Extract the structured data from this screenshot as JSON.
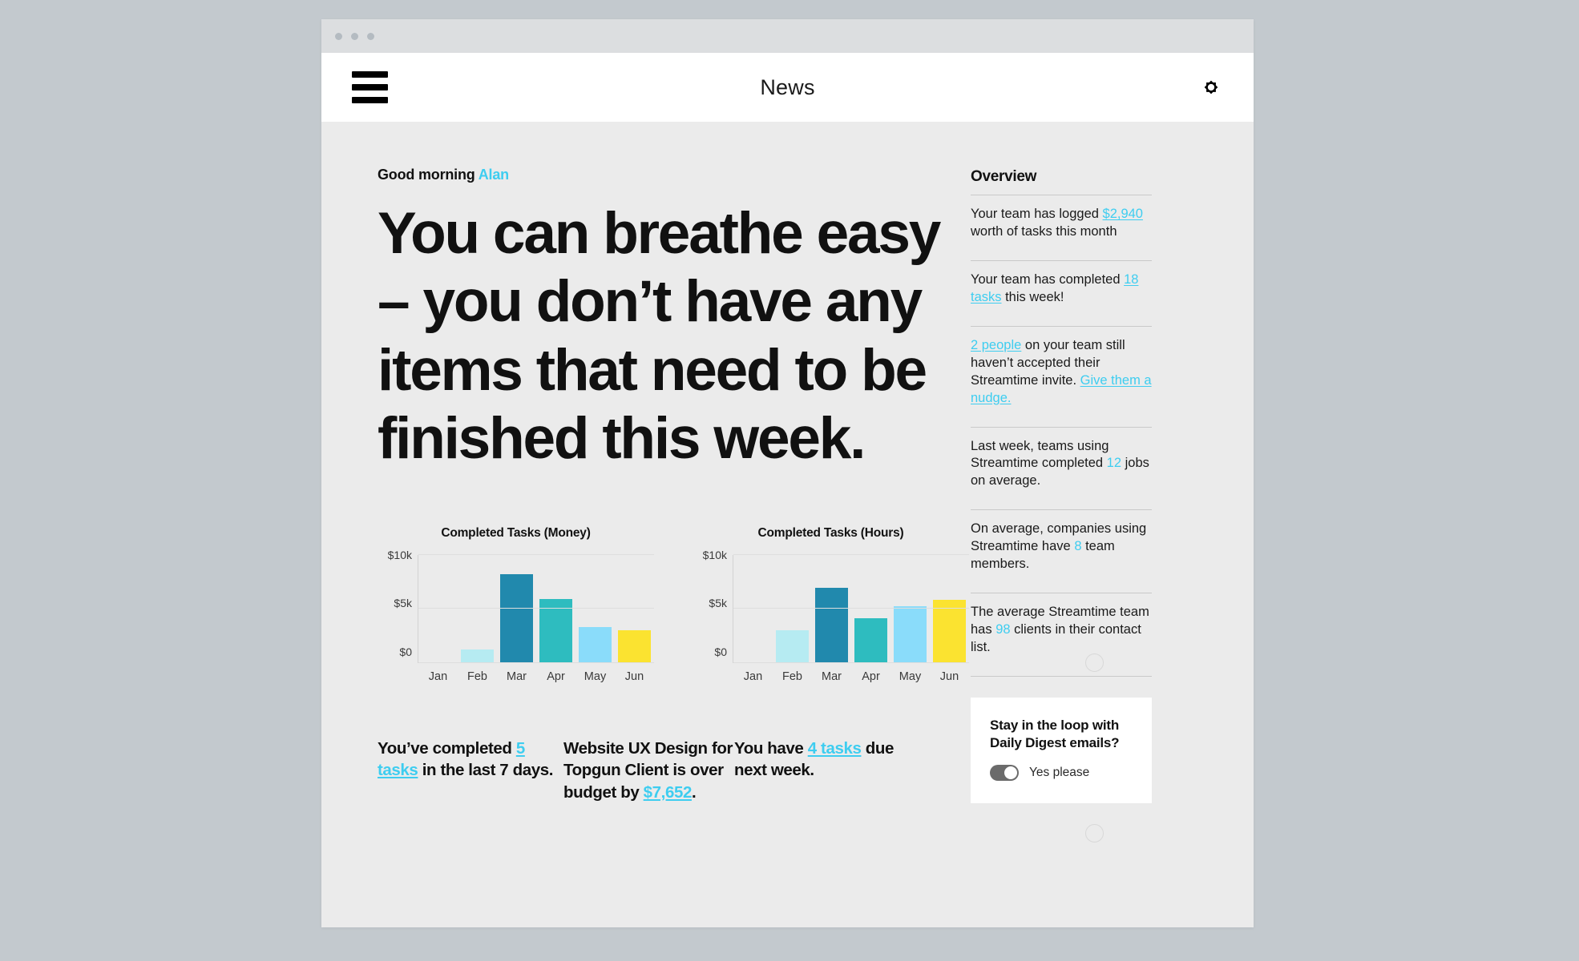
{
  "window": {
    "dots_count": 3,
    "traffic_light_color": "#b4bbc1"
  },
  "header": {
    "title": "News",
    "menu_icon": "hamburger-icon",
    "settings_icon": "gear-icon"
  },
  "greeting": {
    "text": "Good morning ",
    "name": "Alan"
  },
  "headline": "You can breathe easy – you don’t have any items that need to be finished this week.",
  "colors": {
    "accent": "#3ecdf0",
    "page_bg": "#ebebeb",
    "desktop_bg": "#c3c9ce",
    "bar_feb": "#b6ebf2",
    "bar_mar": "#2189ad",
    "bar_apr": "#2ebcbf",
    "bar_may": "#8adcfa",
    "bar_jun": "#fbe330"
  },
  "chart_data": [
    {
      "type": "bar",
      "title": "Completed Tasks (Money)",
      "categories": [
        "Jan",
        "Feb",
        "Mar",
        "Apr",
        "May",
        "Jun"
      ],
      "values": [
        0,
        1200,
        8200,
        5900,
        3300,
        3000
      ],
      "colors": [
        "#b6ebf2",
        "#b6ebf2",
        "#2189ad",
        "#2ebcbf",
        "#8adcfa",
        "#fbe330"
      ],
      "ylim": [
        0,
        10000
      ],
      "yticks": [
        0,
        5000,
        10000
      ],
      "ytick_labels": [
        "$0",
        "$5k",
        "$10k"
      ],
      "xlabel": "",
      "ylabel": "",
      "grid": true,
      "legend": "none"
    },
    {
      "type": "bar",
      "title": "Completed Tasks (Hours)",
      "categories": [
        "Jan",
        "Feb",
        "Mar",
        "Apr",
        "May",
        "Jun"
      ],
      "values": [
        0,
        3000,
        6900,
        4100,
        5200,
        5800
      ],
      "colors": [
        "#b6ebf2",
        "#b6ebf2",
        "#2189ad",
        "#2ebcbf",
        "#8adcfa",
        "#fbe330"
      ],
      "ylim": [
        0,
        10000
      ],
      "yticks": [
        0,
        5000,
        10000
      ],
      "ytick_labels": [
        "$0",
        "$5k",
        "$10k"
      ],
      "xlabel": "",
      "ylabel": "",
      "grid": true,
      "legend": "none"
    }
  ],
  "stats": [
    {
      "parts": [
        {
          "t": "You’ve completed ",
          "style": "plain"
        },
        {
          "t": "5 tasks",
          "style": "link"
        },
        {
          "t": " in the last 7 days.",
          "style": "plain"
        }
      ]
    },
    {
      "parts": [
        {
          "t": "Website UX Design for Topgun Client is over budget by ",
          "style": "plain"
        },
        {
          "t": "$7,652",
          "style": "link"
        },
        {
          "t": ".",
          "style": "plain"
        }
      ]
    },
    {
      "parts": [
        {
          "t": "You have ",
          "style": "plain"
        },
        {
          "t": "4 tasks",
          "style": "link"
        },
        {
          "t": " due next week.",
          "style": "plain"
        }
      ]
    }
  ],
  "sidebar": {
    "title": "Overview",
    "items": [
      {
        "parts": [
          {
            "t": "Your team has logged ",
            "style": "plain"
          },
          {
            "t": "$2,940",
            "style": "link"
          },
          {
            "t": " worth of tasks this month",
            "style": "plain"
          }
        ]
      },
      {
        "parts": [
          {
            "t": "Your team has completed ",
            "style": "plain"
          },
          {
            "t": "18 tasks",
            "style": "link"
          },
          {
            "t": " this week!",
            "style": "plain"
          }
        ]
      },
      {
        "parts": [
          {
            "t": "2 people",
            "style": "link"
          },
          {
            "t": " on your team still haven’t accepted their Streamtime invite. ",
            "style": "plain"
          },
          {
            "t": "Give them a nudge.",
            "style": "link"
          }
        ]
      },
      {
        "parts": [
          {
            "t": "Last week, teams using Streamtime completed ",
            "style": "plain"
          },
          {
            "t": "12",
            "style": "accent"
          },
          {
            "t": " jobs on average.",
            "style": "plain"
          }
        ]
      },
      {
        "parts": [
          {
            "t": "On average, companies using Streamtime have ",
            "style": "plain"
          },
          {
            "t": "8",
            "style": "accent"
          },
          {
            "t": " team members.",
            "style": "plain"
          }
        ]
      },
      {
        "parts": [
          {
            "t": "The average Streamtime team has ",
            "style": "plain"
          },
          {
            "t": "98",
            "style": "accent"
          },
          {
            "t": " clients in their contact list.",
            "style": "plain"
          }
        ]
      }
    ],
    "digest_card": {
      "title": "Stay in the loop with Daily Digest emails?",
      "toggle_label": "Yes please",
      "toggle_state": "on"
    }
  }
}
